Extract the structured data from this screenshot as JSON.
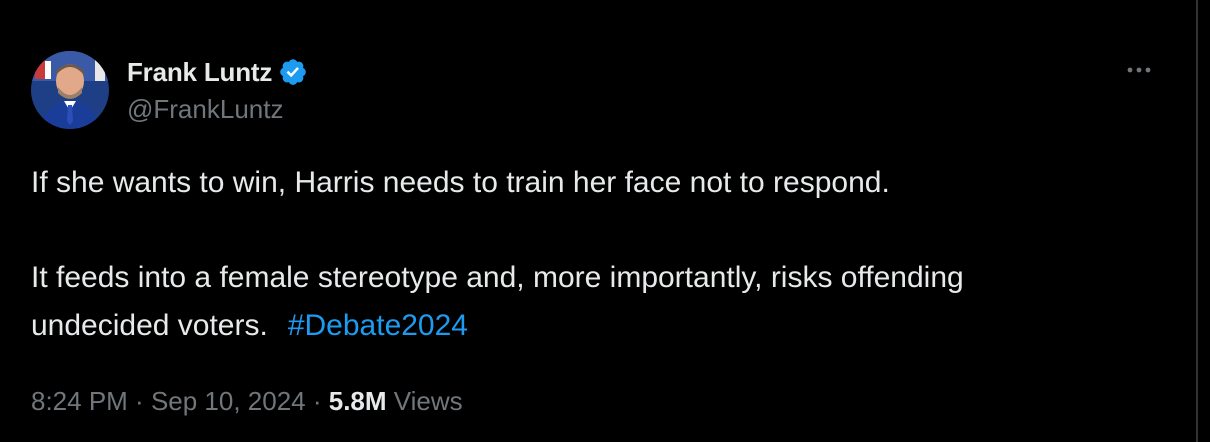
{
  "author": {
    "display_name": "Frank Luntz",
    "handle": "@FrankLuntz",
    "verified": true
  },
  "tweet": {
    "line1": "If she wants to win, Harris needs to train her face not to respond.",
    "line2": "It feeds into a female stereotype and, more importantly, risks offending",
    "line3": "undecided voters.",
    "hashtag": "#Debate2024"
  },
  "meta": {
    "time": "8:24 PM",
    "separator1": " · ",
    "date": "Sep 10, 2024",
    "separator2": " · ",
    "views_count": "5.8M",
    "views_label": " Views"
  },
  "colors": {
    "background": "#000000",
    "text_primary": "#e7e9ea",
    "text_secondary": "#71767b",
    "accent": "#1d9bf0"
  },
  "icons": {
    "verified": "verified-badge-icon",
    "more": "more-options-icon"
  }
}
